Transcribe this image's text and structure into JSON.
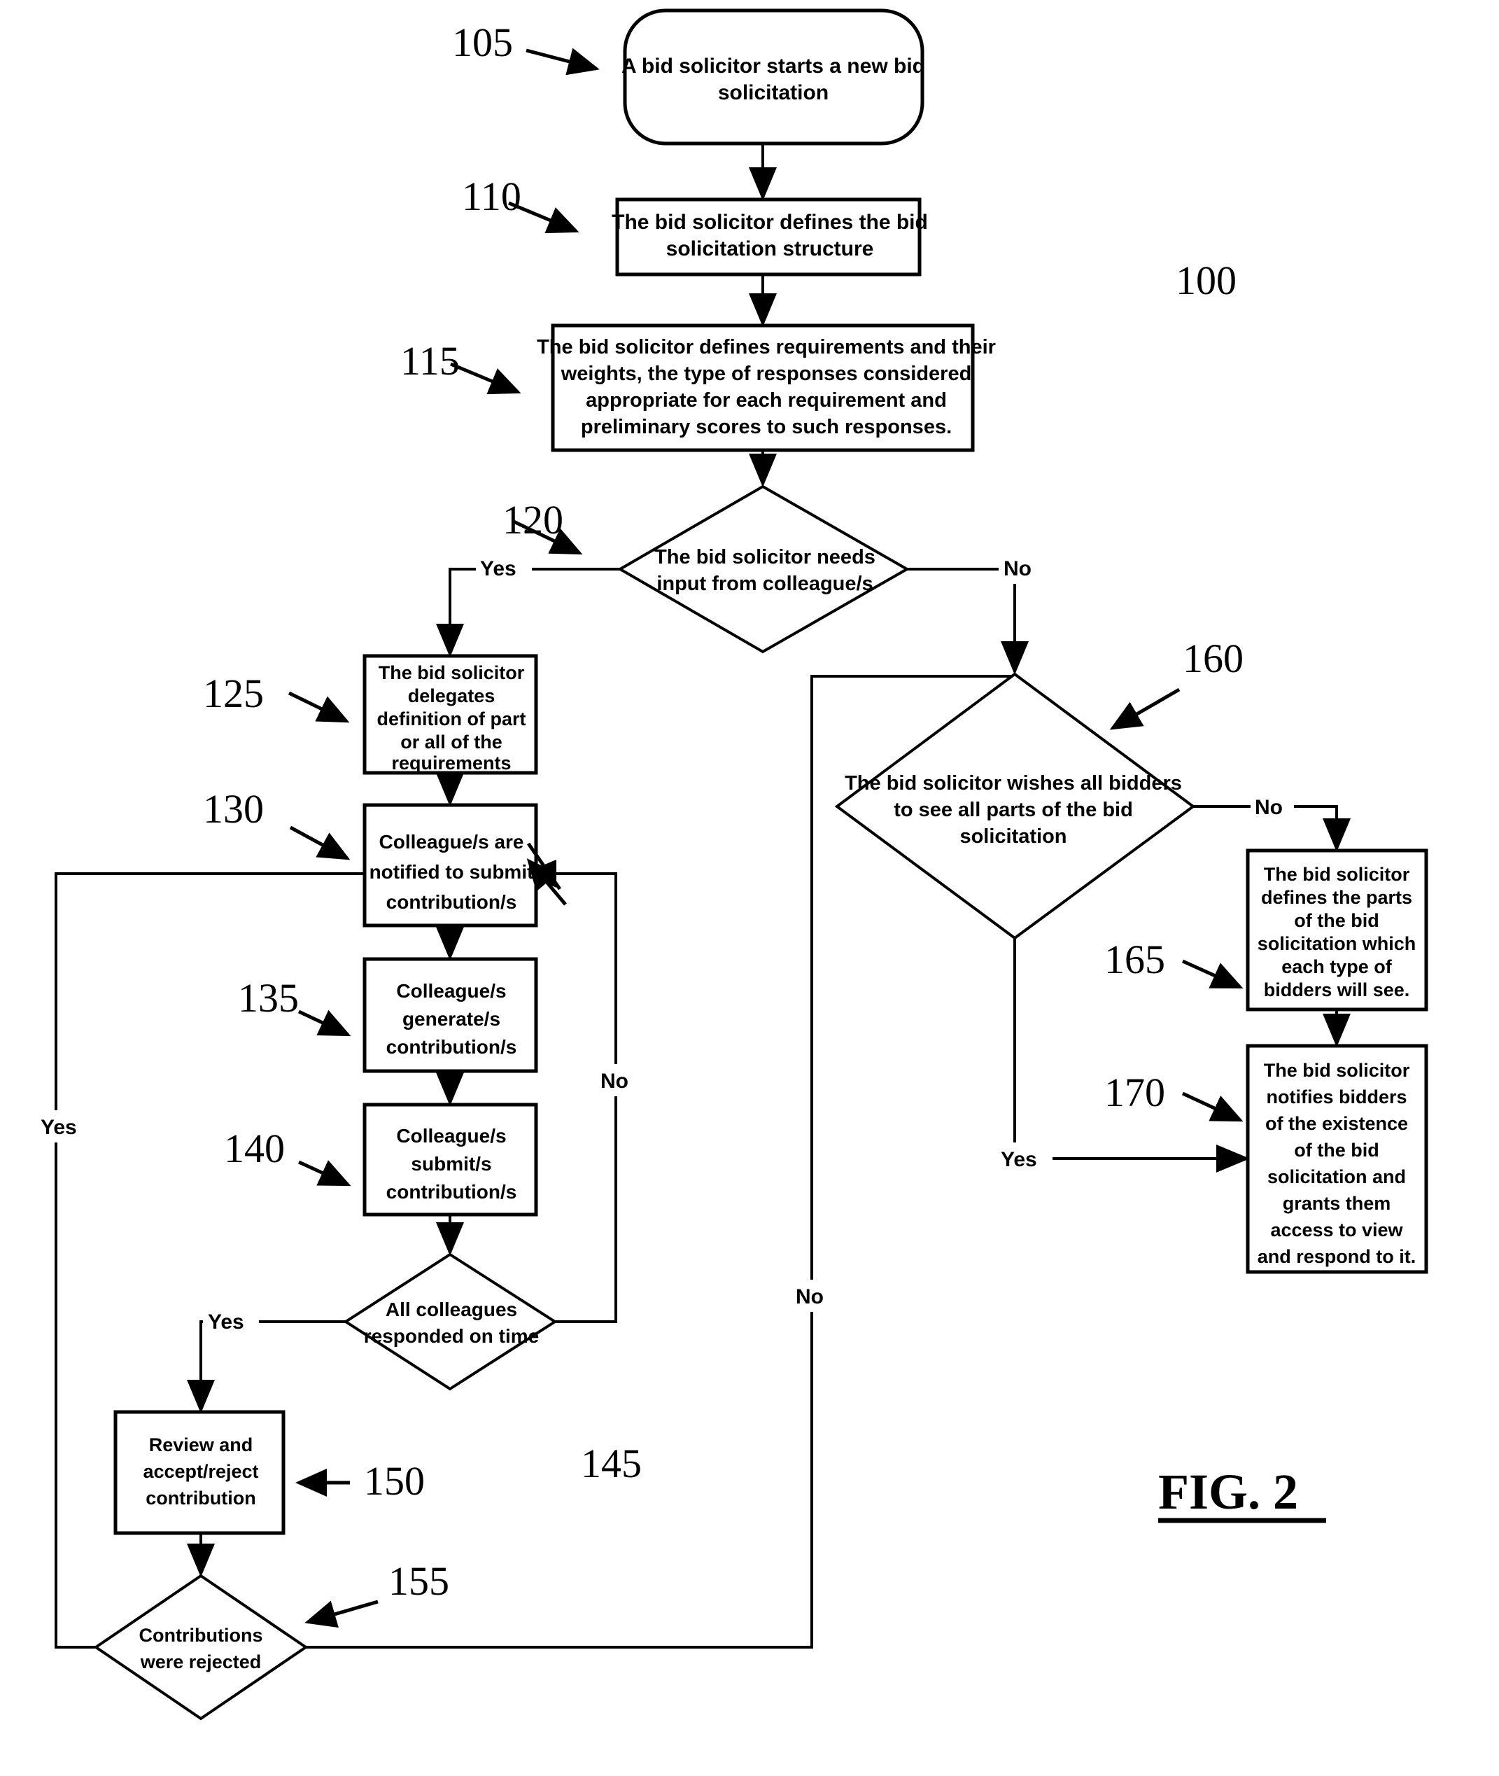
{
  "figure": {
    "label": "FIG. 2",
    "system_ref": "100"
  },
  "nodes": [
    {
      "ref": "105",
      "shape": "rounded-rectangle",
      "lines": [
        "A bid solicitor starts a new bid",
        "solicitation"
      ]
    },
    {
      "ref": "110",
      "shape": "rectangle",
      "lines": [
        "The bid solicitor defines the bid",
        "solicitation structure"
      ]
    },
    {
      "ref": "115",
      "shape": "rectangle",
      "lines": [
        "The bid solicitor defines requirements and their",
        "weights, the type of responses considered",
        "appropriate for each requirement and",
        "preliminary scores to such responses."
      ]
    },
    {
      "ref": "120",
      "shape": "diamond",
      "lines": [
        "The bid solicitor needs",
        "input from colleague/s"
      ]
    },
    {
      "ref": "125",
      "shape": "rectangle",
      "lines": [
        "The bid solicitor",
        "delegates",
        "definition of part",
        "or all of the",
        "requirements"
      ]
    },
    {
      "ref": "130",
      "shape": "rectangle",
      "lines": [
        "Colleague/s are",
        "notified to submit",
        "contribution/s"
      ]
    },
    {
      "ref": "135",
      "shape": "rectangle",
      "lines": [
        "Colleague/s",
        "generate/s",
        "contribution/s"
      ]
    },
    {
      "ref": "140",
      "shape": "rectangle",
      "lines": [
        "Colleague/s",
        "submit/s",
        "contribution/s"
      ]
    },
    {
      "ref": "145",
      "shape": "diamond",
      "lines": [
        "All colleagues",
        "responded on time"
      ]
    },
    {
      "ref": "150",
      "shape": "rectangle",
      "lines": [
        "Review and",
        "accept/reject",
        "contribution"
      ]
    },
    {
      "ref": "155",
      "shape": "diamond",
      "lines": [
        "Contributions",
        "were rejected"
      ]
    },
    {
      "ref": "160",
      "shape": "diamond",
      "lines": [
        "The bid solicitor wishes all bidders",
        "to see all parts of the bid",
        "solicitation"
      ]
    },
    {
      "ref": "165",
      "shape": "rectangle",
      "lines": [
        "The bid solicitor",
        "defines the parts",
        "of the bid",
        "solicitation which",
        "each type of",
        "bidders will see."
      ]
    },
    {
      "ref": "170",
      "shape": "rectangle",
      "lines": [
        "The bid solicitor",
        "notifies bidders",
        "of the existence",
        "of the bid",
        "solicitation and",
        "grants them",
        "access to view",
        "and respond to it."
      ]
    }
  ],
  "edge_labels": {
    "d120_yes": "Yes",
    "d120_no": "No",
    "d145_yes": "Yes",
    "d145_no": "No",
    "d155_yes": "Yes",
    "d155_no": "No",
    "d160_yes": "Yes",
    "d160_no": "No"
  },
  "colors": {
    "stroke": "#000000",
    "fill": "#ffffff",
    "background": "#ffffff"
  }
}
